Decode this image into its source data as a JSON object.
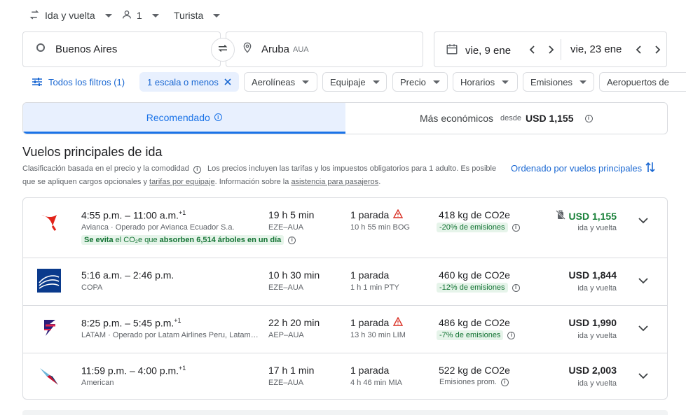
{
  "top": {
    "trip_type": "Ida y vuelta",
    "passengers": "1",
    "cabin": "Turista"
  },
  "search": {
    "origin": "Buenos Aires",
    "destination": "Aruba",
    "destination_code": "AUA",
    "depart_date": "vie, 9 ene",
    "return_date": "vie, 23 ene"
  },
  "filters": {
    "all_filters": "Todos los filtros (1)",
    "stops": "1 escala o menos",
    "airlines": "Aerolíneas",
    "baggage": "Equipaje",
    "price": "Precio",
    "times": "Horarios",
    "emissions": "Emisiones",
    "airports": "Aeropuertos de"
  },
  "tabs": {
    "recommended": "Recomendado",
    "cheapest": "Más económicos",
    "from_label": "desde",
    "cheapest_price": "USD 1,155"
  },
  "heading": {
    "title": "Vuelos principales de ida",
    "desc_1": "Clasificación basada en el precio y la comodidad",
    "desc_2": "Los precios incluyen las tarifas y los impuestos obligatorios para 1 adulto. Es posible que se apliquen cargos opcionales y",
    "baggage_link": "tarifas por equipaje",
    "desc_3": ". Información sobre la",
    "assist_link": "asistencia para pasajeros",
    "desc_4": ".",
    "sort": "Ordenado por vuelos principales"
  },
  "flights": [
    {
      "times": "4:55 p.m. – 11:00 a.m.",
      "plus": "+1",
      "airline": "Avianca · Operado por Avianca Ecuador S.a.",
      "eco_a": "Se evita",
      "eco_b": "el CO₂e que",
      "eco_c": "absorben 6,514 árboles en un día",
      "duration": "19 h 5 min",
      "route": "EZE–AUA",
      "stops": "1 parada",
      "stop_detail": "10 h 55 min BOG",
      "co2": "418 kg de CO2e",
      "emissions": "-20% de emisiones",
      "price": "USD 1,155",
      "rt": "ida y vuelta"
    },
    {
      "times": "5:16 a.m. – 2:46 p.m.",
      "plus": "",
      "airline": "COPA",
      "duration": "10 h 30 min",
      "route": "EZE–AUA",
      "stops": "1 parada",
      "stop_detail": "1 h 1 min PTY",
      "co2": "460 kg de CO2e",
      "emissions": "-12% de emisiones",
      "price": "USD 1,844",
      "rt": "ida y vuelta"
    },
    {
      "times": "8:25 p.m. – 5:45 p.m.",
      "plus": "+1",
      "airline": "LATAM · Operado por Latam Airlines Peru, Latam …",
      "duration": "22 h 20 min",
      "route": "AEP–AUA",
      "stops": "1 parada",
      "stop_detail": "13 h 30 min LIM",
      "co2": "486 kg de CO2e",
      "emissions": "-7% de emisiones",
      "price": "USD 1,990",
      "rt": "ida y vuelta"
    },
    {
      "times": "11:59 p.m. – 4:00 p.m.",
      "plus": "+1",
      "airline": "American",
      "duration": "17 h 1 min",
      "route": "EZE–AUA",
      "stops": "1 parada",
      "stop_detail": "4 h 46 min MIA",
      "co2": "522 kg de CO2e",
      "emissions": "Emisiones prom.",
      "price": "USD 2,003",
      "rt": "ida y vuelta"
    }
  ],
  "colors": {
    "accent": "#1a73e8",
    "green": "#188038",
    "warning": "#d93025"
  }
}
